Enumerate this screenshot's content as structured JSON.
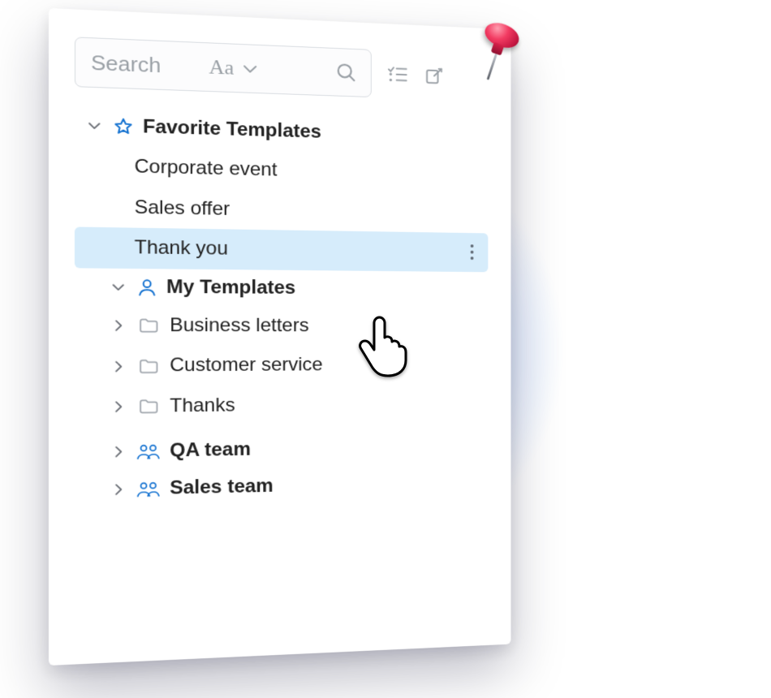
{
  "search": {
    "placeholder": "Search",
    "case_label": "Aa"
  },
  "tree": {
    "favorites": {
      "label": "Favorite Templates",
      "expanded": true,
      "items": [
        "Corporate event",
        "Sales offer",
        "Thank you"
      ],
      "selected_index": 2
    },
    "mytemplates": {
      "label": "My Templates",
      "expanded": true,
      "folders": [
        "Business letters",
        "Customer service",
        "Thanks"
      ]
    },
    "teams": [
      {
        "label": "QA team"
      },
      {
        "label": "Sales team"
      }
    ]
  }
}
